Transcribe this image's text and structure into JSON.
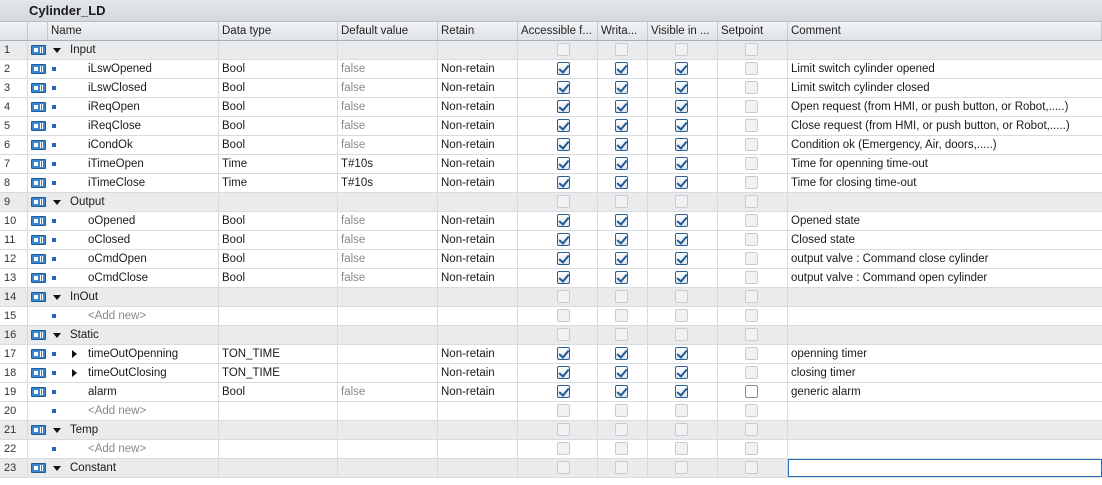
{
  "block_title": "Cylinder_LD",
  "columns": {
    "name": "Name",
    "data_type": "Data type",
    "default_value": "Default value",
    "retain": "Retain",
    "accessible": "Accessible f...",
    "writable": "Writa...",
    "visible": "Visible in ...",
    "setpoint": "Setpoint",
    "comment": "Comment"
  },
  "rows": [
    {
      "num": "1",
      "kind": "section",
      "name": "Input",
      "type": "",
      "default": "",
      "retain": "",
      "acc": false,
      "wri": false,
      "vis": false,
      "set": false,
      "comment": ""
    },
    {
      "num": "2",
      "kind": "var",
      "name": "iLswOpened",
      "type": "Bool",
      "default": "false",
      "retain": "Non-retain",
      "acc": true,
      "wri": true,
      "vis": true,
      "set": false,
      "comment": "Limit switch cylinder opened"
    },
    {
      "num": "3",
      "kind": "var",
      "name": "iLswClosed",
      "type": "Bool",
      "default": "false",
      "retain": "Non-retain",
      "acc": true,
      "wri": true,
      "vis": true,
      "set": false,
      "comment": "Limit switch cylinder closed"
    },
    {
      "num": "4",
      "kind": "var",
      "name": "iReqOpen",
      "type": "Bool",
      "default": "false",
      "retain": "Non-retain",
      "acc": true,
      "wri": true,
      "vis": true,
      "set": false,
      "comment": "Open request (from HMI, or push button, or Robot,.....)"
    },
    {
      "num": "5",
      "kind": "var",
      "name": "iReqClose",
      "type": "Bool",
      "default": "false",
      "retain": "Non-retain",
      "acc": true,
      "wri": true,
      "vis": true,
      "set": false,
      "comment": "Close request (from HMI, or push button, or Robot,.....)"
    },
    {
      "num": "6",
      "kind": "var",
      "name": "iCondOk",
      "type": "Bool",
      "default": "false",
      "retain": "Non-retain",
      "acc": true,
      "wri": true,
      "vis": true,
      "set": false,
      "comment": "Condition ok (Emergency, Air, doors,.....)"
    },
    {
      "num": "7",
      "kind": "var",
      "name": "iTimeOpen",
      "type": "Time",
      "default": "T#10s",
      "default_dark": true,
      "retain": "Non-retain",
      "acc": true,
      "wri": true,
      "vis": true,
      "set": false,
      "comment": "Time for openning time-out"
    },
    {
      "num": "8",
      "kind": "var",
      "name": "iTimeClose",
      "type": "Time",
      "default": "T#10s",
      "default_dark": true,
      "retain": "Non-retain",
      "acc": true,
      "wri": true,
      "vis": true,
      "set": false,
      "comment": "Time for closing time-out"
    },
    {
      "num": "9",
      "kind": "section",
      "name": "Output",
      "type": "",
      "default": "",
      "retain": "",
      "acc": false,
      "wri": false,
      "vis": false,
      "set": false,
      "comment": ""
    },
    {
      "num": "10",
      "kind": "var",
      "name": "oOpened",
      "type": "Bool",
      "default": "false",
      "retain": "Non-retain",
      "acc": true,
      "wri": true,
      "vis": true,
      "set": false,
      "comment": "Opened state"
    },
    {
      "num": "11",
      "kind": "var",
      "name": "oClosed",
      "type": "Bool",
      "default": "false",
      "retain": "Non-retain",
      "acc": true,
      "wri": true,
      "vis": true,
      "set": false,
      "comment": "Closed state"
    },
    {
      "num": "12",
      "kind": "var",
      "name": "oCmdOpen",
      "type": "Bool",
      "default": "false",
      "retain": "Non-retain",
      "acc": true,
      "wri": true,
      "vis": true,
      "set": false,
      "comment": "output valve : Command close cylinder"
    },
    {
      "num": "13",
      "kind": "var",
      "name": "oCmdClose",
      "type": "Bool",
      "default": "false",
      "retain": "Non-retain",
      "acc": true,
      "wri": true,
      "vis": true,
      "set": false,
      "comment": "output valve : Command open cylinder"
    },
    {
      "num": "14",
      "kind": "section",
      "name": "InOut",
      "type": "",
      "default": "",
      "retain": "",
      "acc": false,
      "wri": false,
      "vis": false,
      "set": false,
      "comment": ""
    },
    {
      "num": "15",
      "kind": "add",
      "name": "<Add new>",
      "type": "",
      "default": "",
      "retain": "",
      "acc": false,
      "wri": false,
      "vis": false,
      "set": false,
      "comment": ""
    },
    {
      "num": "16",
      "kind": "section",
      "name": "Static",
      "type": "",
      "default": "",
      "retain": "",
      "acc": false,
      "wri": false,
      "vis": false,
      "set": false,
      "comment": ""
    },
    {
      "num": "17",
      "kind": "struct",
      "name": "timeOutOpenning",
      "type": "TON_TIME",
      "default": "",
      "retain": "Non-retain",
      "acc": true,
      "wri": true,
      "vis": true,
      "set": false,
      "comment": "openning timer"
    },
    {
      "num": "18",
      "kind": "struct",
      "name": "timeOutClosing",
      "type": "TON_TIME",
      "default": "",
      "retain": "Non-retain",
      "acc": true,
      "wri": true,
      "vis": true,
      "set": false,
      "comment": "closing timer"
    },
    {
      "num": "19",
      "kind": "var",
      "name": "alarm",
      "type": "Bool",
      "default": "false",
      "retain": "Non-retain",
      "acc": true,
      "wri": true,
      "vis": true,
      "set": false,
      "set_editable": true,
      "comment": "generic alarm"
    },
    {
      "num": "20",
      "kind": "add",
      "name": "<Add new>",
      "type": "",
      "default": "",
      "retain": "",
      "acc": false,
      "wri": false,
      "vis": false,
      "set": false,
      "comment": ""
    },
    {
      "num": "21",
      "kind": "section",
      "name": "Temp",
      "type": "",
      "default": "",
      "retain": "",
      "acc": false,
      "wri": false,
      "vis": false,
      "set": false,
      "comment": ""
    },
    {
      "num": "22",
      "kind": "add",
      "name": "<Add new>",
      "type": "",
      "default": "",
      "retain": "",
      "acc": false,
      "wri": false,
      "vis": false,
      "set": false,
      "comment": ""
    },
    {
      "num": "23",
      "kind": "section",
      "name": "Constant",
      "type": "",
      "default": "",
      "retain": "",
      "acc": false,
      "wri": false,
      "vis": false,
      "set": false,
      "comment": "",
      "selected": true
    }
  ],
  "icons": {
    "section": "interface-section-icon",
    "variable": "variable-icon",
    "expand_open": "expanded-triangle-icon",
    "expand_closed": "collapsed-triangle-icon"
  },
  "colors": {
    "header_bg": "#e0e4e7",
    "section_bg": "#eaebec",
    "grid_line": "#d8dcdf",
    "checkbox_checked": "#2b5f94",
    "icon_blue": "#3a87d0",
    "selection_outline": "#2a6eb8"
  }
}
